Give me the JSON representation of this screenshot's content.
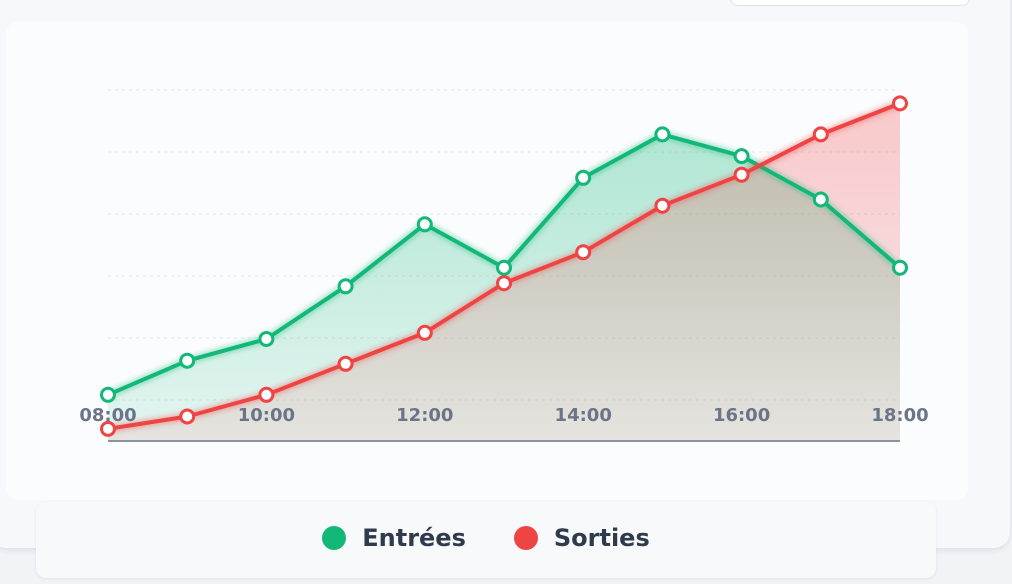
{
  "chart_data": {
    "type": "line",
    "x": [
      "08:00",
      "09:00",
      "10:00",
      "11:00",
      "12:00",
      "13:00",
      "14:00",
      "15:00",
      "16:00",
      "17:00",
      "18:00"
    ],
    "x_tick_labels": [
      "08:00",
      "10:00",
      "12:00",
      "14:00",
      "16:00",
      "18:00"
    ],
    "ylim": [
      0,
      100
    ],
    "grid": true,
    "legend_position": "bottom",
    "series": [
      {
        "name": "Entrées",
        "color": "#12b878",
        "values": [
          12,
          23,
          30,
          47,
          67,
          53,
          82,
          96,
          89,
          75,
          53
        ]
      },
      {
        "name": "Sorties",
        "color": "#ef4444",
        "values": [
          1,
          5,
          12,
          22,
          32,
          48,
          58,
          73,
          83,
          96,
          106
        ]
      }
    ]
  },
  "legend": {
    "entrees": {
      "label": "Entrées",
      "color": "#12b878"
    },
    "sorties": {
      "label": "Sorties",
      "color": "#ef4444"
    }
  }
}
